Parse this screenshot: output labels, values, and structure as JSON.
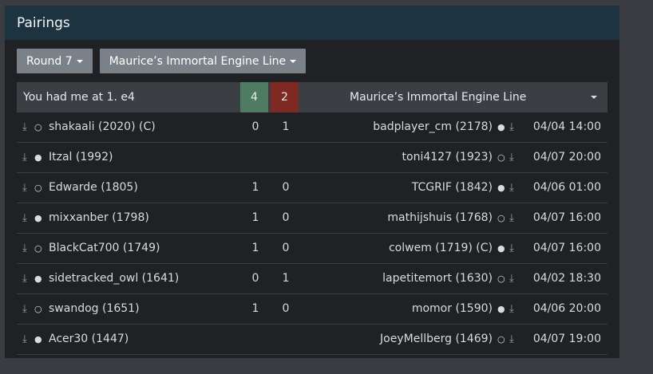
{
  "panel": {
    "title": "Pairings"
  },
  "controls": {
    "round_label": "Round 7",
    "team_label": "Maurice’s Immortal Engine Line"
  },
  "header": {
    "left_team": "You had me at 1. e4",
    "left_score": "4",
    "right_score": "2",
    "right_team": "Maurice’s Immortal Engine Line",
    "left_score_color": "#4f7b62",
    "right_score_color": "#7e2a22"
  },
  "icons": {
    "download": "download-icon",
    "white_piece": "○",
    "black_piece": "●"
  },
  "rows": [
    {
      "left": "shakaali (2020) (C)",
      "left_color": "○",
      "s1": "0",
      "s2": "1",
      "right": "badplayer_cm (2178)",
      "right_color": "●",
      "time": "04/04 14:00"
    },
    {
      "left": "Itzal (1992)",
      "left_color": "●",
      "s1": "",
      "s2": "",
      "right": "toni4127 (1923)",
      "right_color": "○",
      "time": "04/07 20:00"
    },
    {
      "left": "Edwarde (1805)",
      "left_color": "○",
      "s1": "1",
      "s2": "0",
      "right": "TCGRIF (1842)",
      "right_color": "●",
      "time": "04/06 01:00"
    },
    {
      "left": "mixxanber (1798)",
      "left_color": "●",
      "s1": "1",
      "s2": "0",
      "right": "mathijshuis (1768)",
      "right_color": "○",
      "time": "04/07 16:00"
    },
    {
      "left": "BlackCat700 (1749)",
      "left_color": "○",
      "s1": "1",
      "s2": "0",
      "right": "colwem (1719) (C)",
      "right_color": "●",
      "time": "04/07 16:00"
    },
    {
      "left": "sidetracked_owl (1641)",
      "left_color": "●",
      "s1": "0",
      "s2": "1",
      "right": "lapetitemort (1630)",
      "right_color": "○",
      "time": "04/02 18:30"
    },
    {
      "left": "swandog (1651)",
      "left_color": "○",
      "s1": "1",
      "s2": "0",
      "right": "momor (1590)",
      "right_color": "●",
      "time": "04/06 20:00"
    },
    {
      "left": "Acer30 (1447)",
      "left_color": "●",
      "s1": "",
      "s2": "",
      "right": "JoeyMellberg (1469)",
      "right_color": "○",
      "time": "04/07 19:00"
    }
  ]
}
